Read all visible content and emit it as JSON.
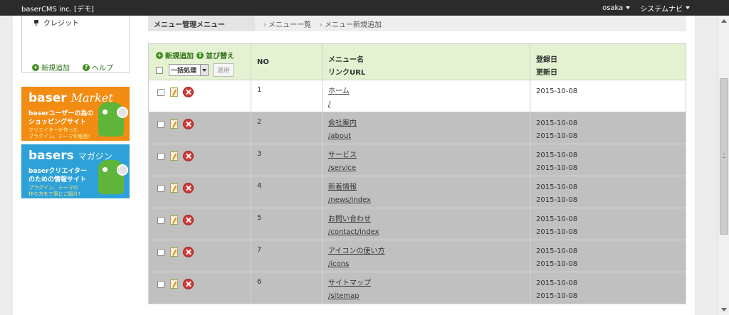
{
  "toolbar": {
    "site_title": "baserCMS inc. [デモ]",
    "user_menu": "osaka",
    "system_menu": "システムナビ"
  },
  "sidebar": {
    "credit_link": "クレジット",
    "add_label": "新規追加",
    "help_label": "ヘルプ"
  },
  "banners": [
    {
      "title_a": "baser",
      "title_b": "Market",
      "line1": "baserユーザーの為の",
      "line2": "ショッピングサイト",
      "small1": "クリエイターが作った",
      "small2": "プラグイン、テーマを販売!",
      "bg": "#f28c12"
    },
    {
      "title_a": "basers",
      "title_b": "マガジン",
      "line1": "baserクリエイター",
      "line2": "のための情報サイト",
      "small1": "プラグイン、テーマの",
      "small2": "作り方を丁寧にご紹介!",
      "bg": "#2ea2d8"
    }
  ],
  "breadcrumb": {
    "section": "メニュー管理メニュー",
    "items": [
      "メニュー一覧",
      "メニュー新規追加"
    ]
  },
  "table": {
    "tools": {
      "add_label": "新規追加",
      "sort_label": "並び替え",
      "bulk_label": "一括処理",
      "apply_label": "適用"
    },
    "headers": {
      "no": "NO",
      "name": "メニュー名",
      "url": "リンクURL",
      "created": "登録日",
      "modified": "更新日"
    },
    "rows": [
      {
        "no": "1",
        "name": "ホーム",
        "url": "/",
        "created": "2015-10-08",
        "modified": ""
      },
      {
        "no": "2",
        "name": "会社案内",
        "url": "/about",
        "created": "2015-10-08",
        "modified": "2015-10-08"
      },
      {
        "no": "3",
        "name": "サービス",
        "url": "/service",
        "created": "2015-10-08",
        "modified": "2015-10-08"
      },
      {
        "no": "4",
        "name": "新着情報",
        "url": "/news/index",
        "created": "2015-10-08",
        "modified": "2015-10-08"
      },
      {
        "no": "5",
        "name": "お問い合わせ",
        "url": "/contact/index",
        "created": "2015-10-08",
        "modified": "2015-10-08"
      },
      {
        "no": "7",
        "name": "アイコンの使い方",
        "url": "/icons",
        "created": "2015-10-08",
        "modified": "2015-10-08"
      },
      {
        "no": "6",
        "name": "サイトマップ",
        "url": "/sitemap",
        "created": "2015-10-08",
        "modified": "2015-10-08"
      }
    ]
  },
  "colors": {
    "header_green": "#e4f2d2",
    "unpublished_row": "#bfc0bf",
    "link_green": "#2b6f12"
  }
}
